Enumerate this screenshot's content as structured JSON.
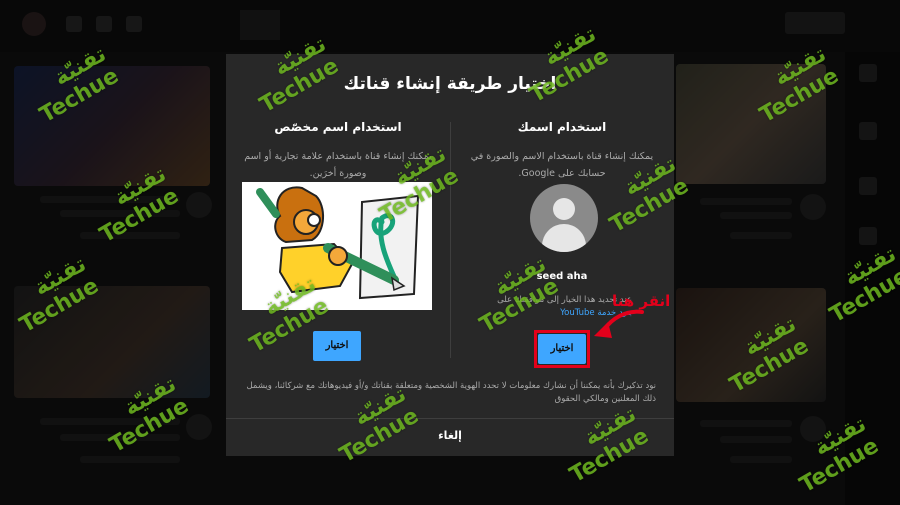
{
  "dialog": {
    "title": "اختيار طريقة إنشاء قناتك",
    "right_option": {
      "title": "استخدام اسمك",
      "description": "يمكنك إنشاء قناة باستخدام الاسم والصورة في حسابك على Google.",
      "channel_name": "seed aha",
      "consent_text": "عند تحديد هذا الخيار إلى موافقتك على",
      "terms_link": "بنود خدمة YouTube",
      "button_label": "اختيار"
    },
    "left_option": {
      "title": "استخدام اسم مخصّص",
      "description": "يمكنك إنشاء قناة باستخدام علامة تجارية أو اسم وصورة أخرَين.",
      "button_label": "اختيار"
    },
    "footnote": "نود تذكيرك بأنه يمكننا أن نشارك معلومات لا تحدد الهوية الشخصية ومتعلقة بقناتك و/أو فيديوهاتك مع شركائنا، ويشمل ذلك المعلنين ومالكي الحقوق",
    "cancel_label": "إلغاء"
  },
  "annotation": {
    "text": "انقر هنا",
    "color": "#e3001b"
  },
  "watermark": {
    "arabic": "تقنيّة",
    "english": "Techue",
    "tag": "MIX",
    "color": "#76c422"
  },
  "colors": {
    "dialog_bg": "#282828",
    "accent": "#3ea6ff"
  },
  "icons": {
    "avatar": "default-avatar-icon",
    "arrow": "red-arrow-icon"
  }
}
